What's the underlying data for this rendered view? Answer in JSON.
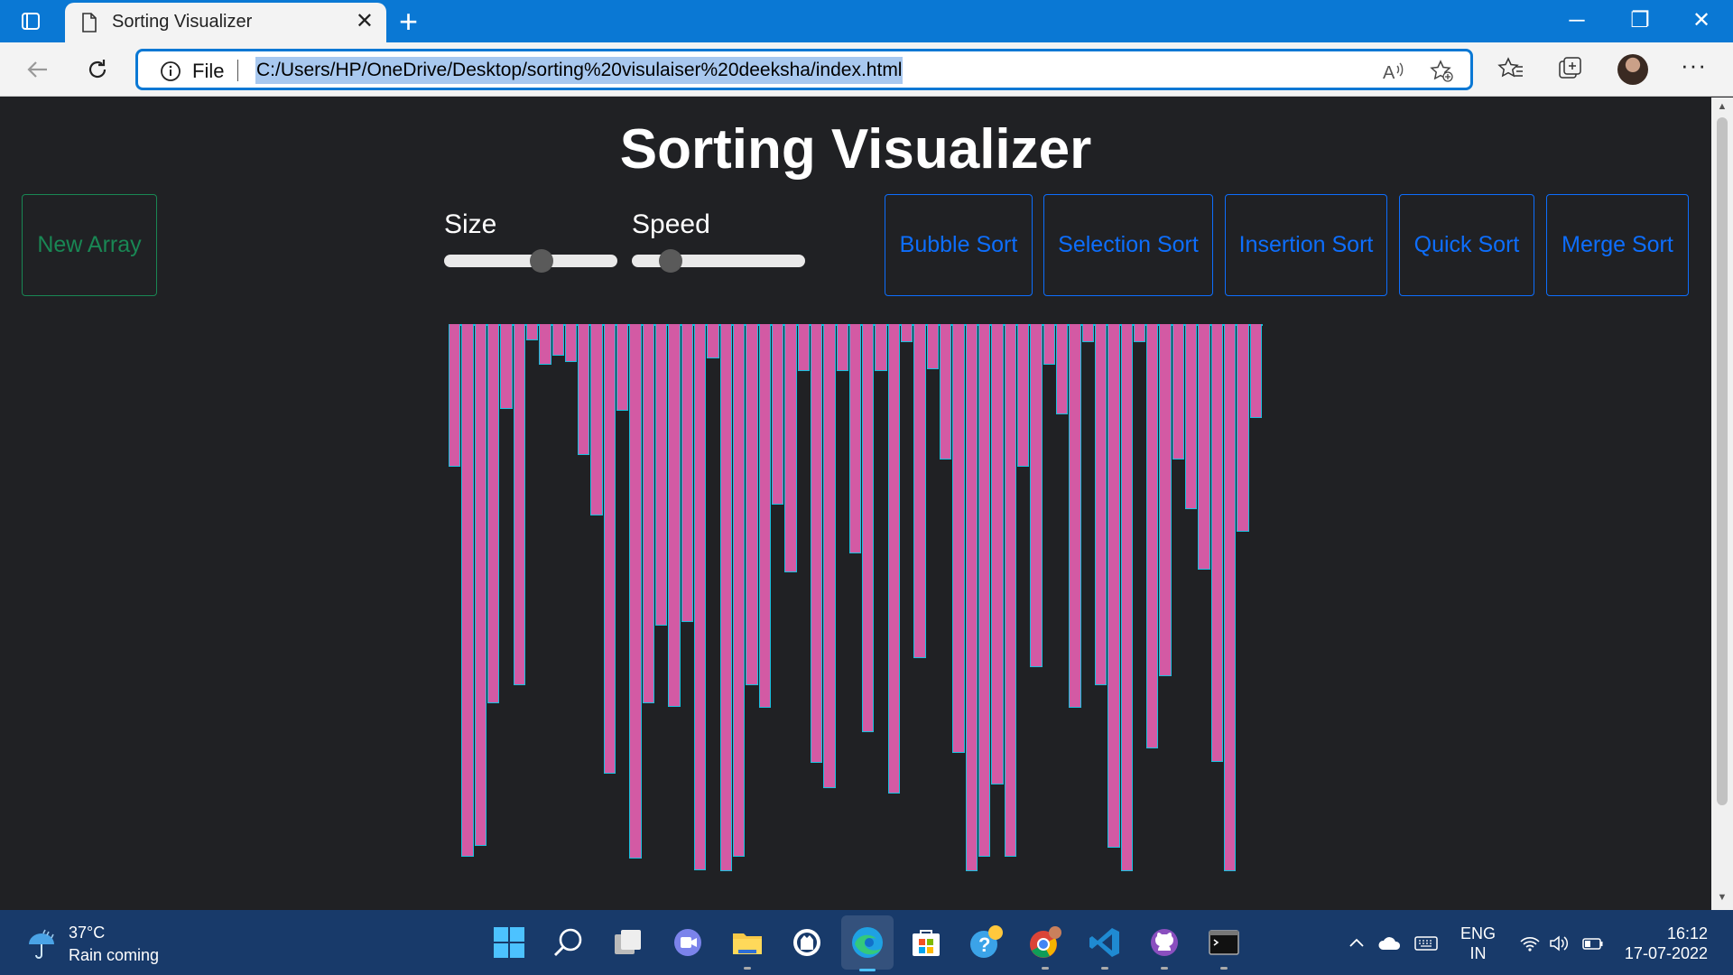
{
  "browser": {
    "tab_title": "Sorting Visualizer",
    "file_label": "File",
    "url": "C:/Users/HP/OneDrive/Desktop/sorting%20visulaiser%20deeksha/index.html",
    "accent": "#0a78d4"
  },
  "page": {
    "title": "Sorting Visualizer",
    "new_array_label": "New Array",
    "size_label": "Size",
    "speed_label": "Speed",
    "size_value_fraction": 0.57,
    "speed_value_fraction": 0.18,
    "sort_buttons": [
      "Bubble Sort",
      "Selection Sort",
      "Insertion Sort",
      "Quick Sort",
      "Merge Sort"
    ],
    "colors": {
      "bar_fill": "#d35aa4",
      "bar_border": "#19c0de",
      "green": "#198754",
      "blue": "#0d6efd"
    }
  },
  "chart_data": {
    "type": "bar",
    "values": [
      158,
      590,
      578,
      420,
      94,
      400,
      18,
      45,
      35,
      42,
      145,
      212,
      498,
      96,
      592,
      420,
      334,
      424,
      330,
      605,
      38,
      606,
      590,
      400,
      425,
      200,
      275,
      52,
      486,
      514,
      52,
      254,
      452,
      52,
      520,
      20,
      370,
      50,
      150,
      475,
      606,
      590,
      510,
      590,
      158,
      380,
      45,
      100,
      425,
      20,
      400,
      580,
      606,
      20,
      470,
      390,
      150,
      205,
      272,
      485,
      606,
      230,
      104
    ]
  },
  "taskbar": {
    "weather_temp": "37°C",
    "weather_desc": "Rain coming",
    "apps": [
      "windows-start-icon",
      "search-icon",
      "task-view-icon",
      "teams-chat-icon",
      "file-explorer-icon",
      "github-desktop-icon",
      "edge-icon",
      "microsoft-store-icon",
      "help-icon",
      "chrome-icon",
      "vscode-icon",
      "github-icon",
      "terminal-icon"
    ],
    "lang_line1": "ENG",
    "lang_line2": "IN",
    "time": "16:12",
    "date": "17-07-2022"
  }
}
